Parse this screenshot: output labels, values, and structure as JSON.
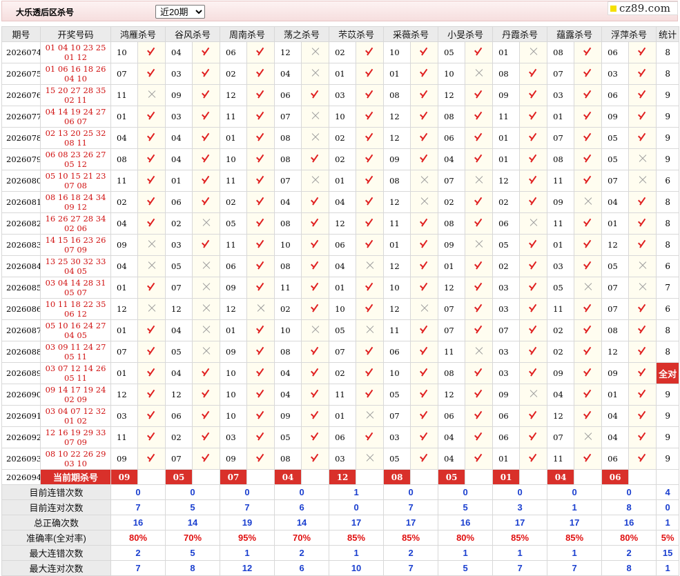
{
  "header": {
    "title": "大乐透后区杀号",
    "range_selected": "近20期",
    "logo": "cz89.com"
  },
  "columns": {
    "issue": "期号",
    "draw": "开奖号码",
    "total": "统计",
    "experts": [
      "鸿雁杀号",
      "谷风杀号",
      "周南杀号",
      "荡之杀号",
      "芣苡杀号",
      "采薇杀号",
      "小旻杀号",
      "丹霞杀号",
      "蕴露杀号",
      "浮萍杀号"
    ]
  },
  "rows": [
    {
      "issue": "2026074",
      "draw": "01 04 10 23 25 01 12",
      "kills": [
        "10",
        "04",
        "06",
        "12",
        "02",
        "10",
        "05",
        "01",
        "08",
        "06"
      ],
      "res": [
        1,
        1,
        1,
        0,
        1,
        1,
        1,
        0,
        1,
        1
      ],
      "total": "8"
    },
    {
      "issue": "2026075",
      "draw": "01 06 16 18 26 04 10",
      "kills": [
        "07",
        "03",
        "02",
        "04",
        "01",
        "01",
        "10",
        "08",
        "07",
        "03"
      ],
      "res": [
        1,
        1,
        1,
        0,
        1,
        1,
        0,
        1,
        1,
        1
      ],
      "total": "8"
    },
    {
      "issue": "2026076",
      "draw": "15 20 27 28 35 02 11",
      "kills": [
        "11",
        "09",
        "12",
        "06",
        "03",
        "08",
        "12",
        "09",
        "03",
        "06"
      ],
      "res": [
        0,
        1,
        1,
        1,
        1,
        1,
        1,
        1,
        1,
        1
      ],
      "total": "9"
    },
    {
      "issue": "2026077",
      "draw": "04 14 19 24 27 06 07",
      "kills": [
        "01",
        "03",
        "11",
        "07",
        "10",
        "12",
        "08",
        "11",
        "01",
        "09"
      ],
      "res": [
        1,
        1,
        1,
        0,
        1,
        1,
        1,
        1,
        1,
        1
      ],
      "total": "9"
    },
    {
      "issue": "2026078",
      "draw": "02 13 20 25 32 08 11",
      "kills": [
        "04",
        "04",
        "01",
        "08",
        "02",
        "12",
        "06",
        "01",
        "07",
        "05"
      ],
      "res": [
        1,
        1,
        1,
        0,
        1,
        1,
        1,
        1,
        1,
        1
      ],
      "total": "9"
    },
    {
      "issue": "2026079",
      "draw": "06 08 23 26 27 05 12",
      "kills": [
        "08",
        "04",
        "10",
        "08",
        "02",
        "09",
        "04",
        "01",
        "08",
        "05"
      ],
      "res": [
        1,
        1,
        1,
        1,
        1,
        1,
        1,
        1,
        1,
        0
      ],
      "total": "9"
    },
    {
      "issue": "2026080",
      "draw": "05 10 15 21 23 07 08",
      "kills": [
        "11",
        "01",
        "11",
        "07",
        "01",
        "08",
        "07",
        "12",
        "11",
        "07"
      ],
      "res": [
        1,
        1,
        1,
        0,
        1,
        0,
        0,
        1,
        1,
        0
      ],
      "total": "6"
    },
    {
      "issue": "2026081",
      "draw": "08 16 18 24 34 09 12",
      "kills": [
        "02",
        "06",
        "02",
        "04",
        "04",
        "12",
        "02",
        "02",
        "09",
        "04"
      ],
      "res": [
        1,
        1,
        1,
        1,
        1,
        0,
        1,
        1,
        0,
        1
      ],
      "total": "8"
    },
    {
      "issue": "2026082",
      "draw": "16 26 27 28 34 02 06",
      "kills": [
        "04",
        "02",
        "05",
        "08",
        "12",
        "11",
        "08",
        "06",
        "11",
        "01"
      ],
      "res": [
        1,
        0,
        1,
        1,
        1,
        1,
        1,
        0,
        1,
        1
      ],
      "total": "8"
    },
    {
      "issue": "2026083",
      "draw": "14 15 16 23 26 07 09",
      "kills": [
        "09",
        "03",
        "11",
        "10",
        "06",
        "01",
        "09",
        "05",
        "01",
        "12"
      ],
      "res": [
        0,
        1,
        1,
        1,
        1,
        1,
        0,
        1,
        1,
        1
      ],
      "total": "8"
    },
    {
      "issue": "2026084",
      "draw": "13 25 30 32 33 04 05",
      "kills": [
        "04",
        "05",
        "06",
        "08",
        "04",
        "12",
        "01",
        "02",
        "03",
        "05"
      ],
      "res": [
        0,
        0,
        1,
        1,
        0,
        1,
        1,
        1,
        1,
        0
      ],
      "total": "6"
    },
    {
      "issue": "2026085",
      "draw": "03 04 14 28 31 05 07",
      "kills": [
        "01",
        "07",
        "09",
        "11",
        "01",
        "10",
        "12",
        "03",
        "05",
        "07"
      ],
      "res": [
        1,
        0,
        1,
        1,
        1,
        1,
        1,
        1,
        0,
        0
      ],
      "total": "7"
    },
    {
      "issue": "2026086",
      "draw": "10 11 18 22 35 06 12",
      "kills": [
        "12",
        "12",
        "12",
        "02",
        "10",
        "12",
        "07",
        "03",
        "11",
        "07"
      ],
      "res": [
        0,
        0,
        0,
        1,
        1,
        0,
        1,
        1,
        1,
        1
      ],
      "total": "6"
    },
    {
      "issue": "2026087",
      "draw": "05 10 16 24 27 04 05",
      "kills": [
        "01",
        "04",
        "01",
        "10",
        "05",
        "11",
        "07",
        "07",
        "02",
        "08"
      ],
      "res": [
        1,
        0,
        1,
        0,
        0,
        1,
        1,
        1,
        1,
        1
      ],
      "total": "8"
    },
    {
      "issue": "2026088",
      "draw": "03 09 11 24 27 05 11",
      "kills": [
        "07",
        "05",
        "09",
        "08",
        "07",
        "06",
        "11",
        "03",
        "02",
        "12"
      ],
      "res": [
        1,
        0,
        1,
        1,
        1,
        1,
        0,
        1,
        1,
        1
      ],
      "total": "8"
    },
    {
      "issue": "2026089",
      "draw": "03 07 12 14 26 05 11",
      "kills": [
        "01",
        "04",
        "10",
        "04",
        "02",
        "10",
        "08",
        "03",
        "09",
        "09"
      ],
      "res": [
        1,
        1,
        1,
        1,
        1,
        1,
        1,
        1,
        1,
        1
      ],
      "total": "全对"
    },
    {
      "issue": "2026090",
      "draw": "09 14 17 19 24 02 09",
      "kills": [
        "12",
        "12",
        "10",
        "04",
        "11",
        "05",
        "12",
        "09",
        "04",
        "01"
      ],
      "res": [
        1,
        1,
        1,
        1,
        1,
        1,
        1,
        0,
        1,
        1
      ],
      "total": "9"
    },
    {
      "issue": "2026091",
      "draw": "03 04 07 12 32 01 02",
      "kills": [
        "03",
        "06",
        "10",
        "09",
        "01",
        "07",
        "06",
        "06",
        "12",
        "04"
      ],
      "res": [
        1,
        1,
        1,
        1,
        0,
        1,
        1,
        1,
        1,
        1
      ],
      "total": "9"
    },
    {
      "issue": "2026092",
      "draw": "12 16 19 29 33 07 09",
      "kills": [
        "11",
        "02",
        "03",
        "05",
        "06",
        "03",
        "04",
        "06",
        "07",
        "04"
      ],
      "res": [
        1,
        1,
        1,
        1,
        1,
        1,
        1,
        1,
        0,
        1
      ],
      "total": "9"
    },
    {
      "issue": "2026093",
      "draw": "08 10 22 26 29 03 10",
      "kills": [
        "09",
        "07",
        "09",
        "08",
        "03",
        "05",
        "04",
        "01",
        "11",
        "06"
      ],
      "res": [
        1,
        1,
        1,
        1,
        0,
        1,
        1,
        1,
        1,
        1
      ],
      "total": "9"
    }
  ],
  "current": {
    "issue": "2026094",
    "label": "当前期杀号",
    "kills": [
      "09",
      "05",
      "07",
      "04",
      "12",
      "08",
      "05",
      "01",
      "04",
      "06"
    ]
  },
  "summary": [
    {
      "label": "目前连错次数",
      "values": [
        "0",
        "0",
        "0",
        "0",
        "1",
        "0",
        "0",
        "0",
        "0",
        "0",
        "4"
      ],
      "red": false
    },
    {
      "label": "目前连对次数",
      "values": [
        "7",
        "5",
        "7",
        "6",
        "0",
        "7",
        "5",
        "3",
        "1",
        "8",
        "0"
      ],
      "red": false
    },
    {
      "label": "总正确次数",
      "values": [
        "16",
        "14",
        "19",
        "14",
        "17",
        "17",
        "16",
        "17",
        "17",
        "16",
        "1"
      ],
      "red": false
    },
    {
      "label": "准确率(全对率)",
      "values": [
        "80%",
        "70%",
        "95%",
        "70%",
        "85%",
        "85%",
        "80%",
        "85%",
        "85%",
        "80%",
        "5%"
      ],
      "red": true
    },
    {
      "label": "最大连错次数",
      "values": [
        "2",
        "5",
        "1",
        "2",
        "1",
        "2",
        "1",
        "1",
        "1",
        "2",
        "15"
      ],
      "red": false
    },
    {
      "label": "最大连对次数",
      "values": [
        "7",
        "8",
        "12",
        "6",
        "10",
        "7",
        "5",
        "7",
        "7",
        "8",
        "1"
      ],
      "red": false
    }
  ],
  "colors": {
    "accent": "#d9302a",
    "correct": "#e02020",
    "blue": "#1a3fcf"
  }
}
